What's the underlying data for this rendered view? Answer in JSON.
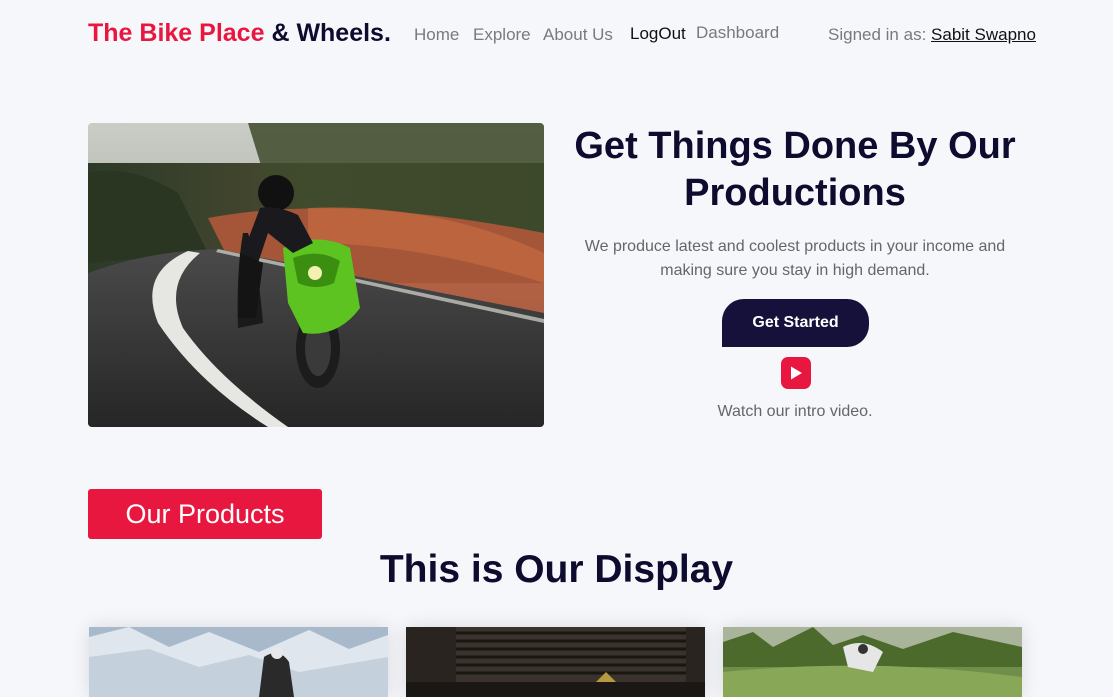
{
  "brand": {
    "part1": "The Bike Place",
    "part2": "& Wheels."
  },
  "nav": {
    "home": "Home",
    "explore": "Explore",
    "about": "About Us",
    "logout": "LogOut",
    "dashboard": "Dashboard"
  },
  "user": {
    "signed_label": "Signed in as:",
    "name": "Sabit Swapno"
  },
  "hero": {
    "title": "Get Things Done By Our Productions",
    "description": "We produce latest and coolest products in your income and making sure you stay in high demand.",
    "cta": "Get Started",
    "video_text": "Watch our intro video."
  },
  "products": {
    "badge": "Our Products",
    "title": "This is Our Display"
  },
  "colors": {
    "accent": "#e8173f",
    "dark": "#0d0b2e",
    "button_dark": "#15113a",
    "background": "#f6f7fb"
  }
}
